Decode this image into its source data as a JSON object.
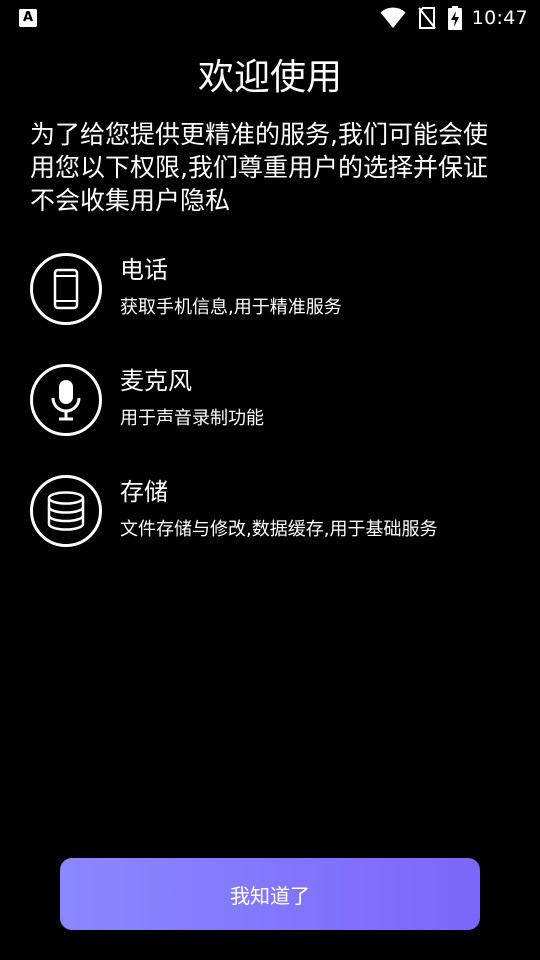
{
  "status_bar": {
    "app_icon_letter": "A",
    "time": "10:47",
    "icons": [
      "wifi-icon",
      "no-sim-icon",
      "battery-charging-icon"
    ]
  },
  "title": "欢迎使用",
  "intro": "为了给您提供更精准的服务,我们可能会使用您以下权限,我们尊重用户的选择并保证不会收集用户隐私",
  "permissions": [
    {
      "icon": "phone-icon",
      "name": "电话",
      "description": "获取手机信息,用于精准服务"
    },
    {
      "icon": "microphone-icon",
      "name": "麦克风",
      "description": "用于声音录制功能"
    },
    {
      "icon": "storage-icon",
      "name": "存储",
      "description": "文件存储与修改,数据缓存,用于基础服务"
    }
  ],
  "confirm_button": {
    "label": "我知道了"
  },
  "colors": {
    "background": "#000000",
    "text": "#ffffff",
    "button_gradient_start": "#8a88ff",
    "button_gradient_end": "#7c66fb"
  }
}
